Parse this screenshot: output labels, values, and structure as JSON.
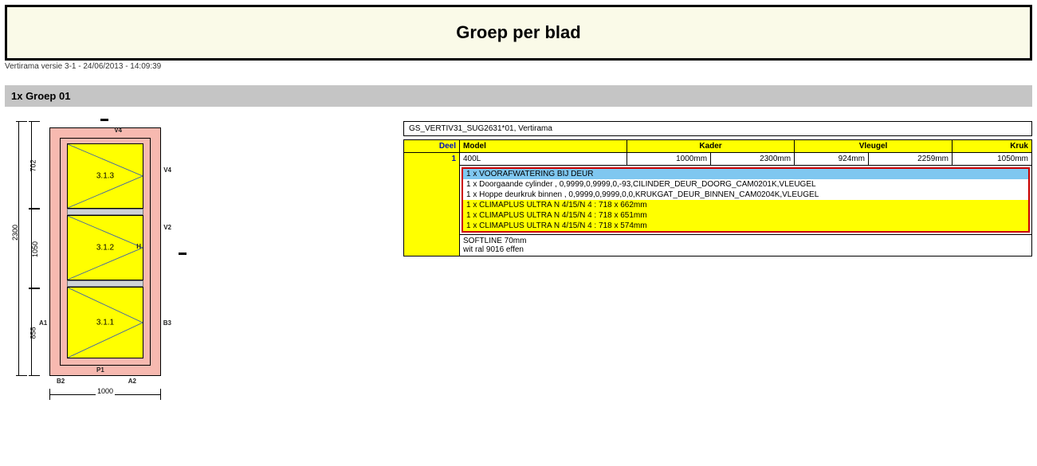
{
  "title": "Groep per blad",
  "version": "Vertirama versie 3-1 - 24/06/2013 - 14:09:39",
  "group_bar": "1x Groep 01",
  "drawing": {
    "height_total": "2300",
    "seg_top": "702",
    "seg_mid": "1050",
    "seg_bot": "858",
    "width": "1000",
    "panel_top_label": "3.1.3",
    "panel_mid_label": "3.1.2",
    "panel_bot_label": "3.1.1",
    "v4": "V4",
    "v2": "V2",
    "b2": "B2",
    "b3": "B3",
    "a1": "A1",
    "a2": "A2",
    "p1": "P1",
    "h_sym": "H",
    "bar_sym": "▬"
  },
  "info_line": "GS_VERTIV31_SUG2631*01, Vertirama",
  "headers": {
    "deel": "Deel",
    "model": "Model",
    "kader": "Kader",
    "vleugel": "Vleugel",
    "kruk": "Kruk"
  },
  "row": {
    "num": "1",
    "model": "400L",
    "kader_w": "1000mm",
    "kader_h": "2300mm",
    "vleugel_w": "924mm",
    "vleugel_h": "2259mm",
    "kruk": "1050mm"
  },
  "detail": {
    "l1": "1 x VOORAFWATERING BIJ DEUR",
    "l2": "1 x Doorgaande cylinder , 0,9999,0,9999,0,-93,CILINDER_DEUR_DOORG_CAM0201K,VLEUGEL",
    "l3": "1 x Hoppe deurkruk binnen , 0,9999,0,9999,0,0,KRUKGAT_DEUR_BINNEN_CAM0204K,VLEUGEL",
    "l4": "1 x CLIMAPLUS ULTRA N 4/15/N 4  : 718 x 662mm",
    "l5": "1 x CLIMAPLUS ULTRA N 4/15/N 4  : 718 x 651mm",
    "l6": "1 x CLIMAPLUS ULTRA N 4/15/N 4  : 718 x 574mm"
  },
  "footer": {
    "l1": "SOFTLINE 70mm",
    "l2": "wit ral 9016 effen"
  }
}
